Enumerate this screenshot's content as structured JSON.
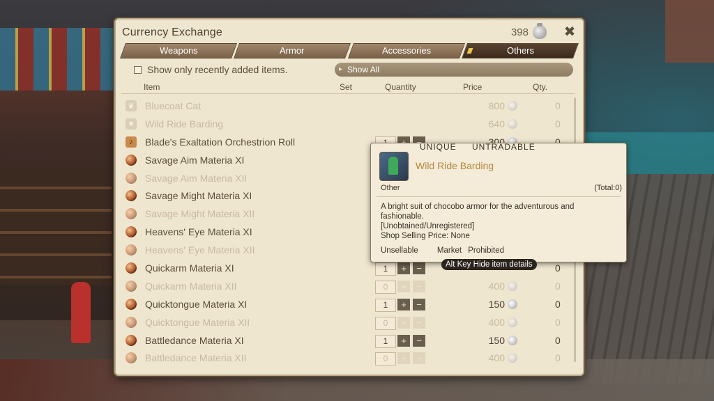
{
  "window": {
    "title": "Currency Exchange",
    "currency_amount": "398",
    "currency_icon": "gil-bag-icon",
    "settings_icon": "settings-icon"
  },
  "tabs": [
    {
      "label": "Weapons",
      "active": false
    },
    {
      "label": "Armor",
      "active": false
    },
    {
      "label": "Accessories",
      "active": false
    },
    {
      "label": "Others",
      "active": true
    }
  ],
  "filter": {
    "checkbox_label": "Show only recently added items.",
    "dropdown_value": "Show All"
  },
  "columns": {
    "item": "Item",
    "set": "Set",
    "quantity": "Quantity",
    "price": "Price",
    "qty": "Qty."
  },
  "items": [
    {
      "name": "Bluecoat Cat",
      "icon": "minion-icon",
      "dim": true,
      "quantity": "",
      "price": "800",
      "owned": "0",
      "controls": false
    },
    {
      "name": "Wild Ride Barding",
      "icon": "star-icon",
      "dim": true,
      "quantity": "",
      "price": "640",
      "owned": "0",
      "controls": false
    },
    {
      "name": "Blade's Exaltation Orchestrion Roll",
      "icon": "music-icon",
      "dim": false,
      "quantity": "1",
      "price": "300",
      "owned": "0",
      "controls": true
    },
    {
      "name": "Savage Aim Materia XI",
      "icon": "materia-icon",
      "dim": false,
      "quantity": "",
      "price": "",
      "owned": "",
      "controls": false
    },
    {
      "name": "Savage Aim Materia XII",
      "icon": "materia-icon",
      "dim": true,
      "quantity": "",
      "price": "",
      "owned": "",
      "controls": false
    },
    {
      "name": "Savage Might Materia XI",
      "icon": "materia-icon",
      "dim": false,
      "quantity": "",
      "price": "",
      "owned": "",
      "controls": false
    },
    {
      "name": "Savage Might Materia XII",
      "icon": "materia-icon",
      "dim": true,
      "quantity": "",
      "price": "",
      "owned": "",
      "controls": false
    },
    {
      "name": "Heavens' Eye Materia XI",
      "icon": "materia-icon",
      "dim": false,
      "quantity": "",
      "price": "",
      "owned": "",
      "controls": false
    },
    {
      "name": "Heavens' Eye Materia XII",
      "icon": "materia-icon",
      "dim": true,
      "quantity": "",
      "price": "",
      "owned": "",
      "controls": false
    },
    {
      "name": "Quickarm Materia XI",
      "icon": "materia-icon",
      "dim": false,
      "quantity": "1",
      "price": "",
      "owned": "0",
      "controls": true
    },
    {
      "name": "Quickarm Materia XII",
      "icon": "materia-icon",
      "dim": true,
      "quantity": "0",
      "price": "400",
      "owned": "0",
      "controls": true
    },
    {
      "name": "Quicktongue Materia XI",
      "icon": "materia-icon",
      "dim": false,
      "quantity": "1",
      "price": "150",
      "owned": "0",
      "controls": true
    },
    {
      "name": "Quicktongue Materia XII",
      "icon": "materia-icon",
      "dim": true,
      "quantity": "0",
      "price": "400",
      "owned": "0",
      "controls": true
    },
    {
      "name": "Battledance Materia XI",
      "icon": "materia-icon",
      "dim": false,
      "quantity": "1",
      "price": "150",
      "owned": "0",
      "controls": true
    },
    {
      "name": "Battledance Materia XII",
      "icon": "materia-icon",
      "dim": true,
      "quantity": "0",
      "price": "400",
      "owned": "0",
      "controls": true
    }
  ],
  "tooltip": {
    "tag_unique": "UNIQUE",
    "tag_untradable": "UNTRADABLE",
    "item_name": "Wild Ride Barding",
    "category": "Other",
    "total": "(Total:0)",
    "description_line1": "A bright suit of chocobo armor for the adventurous and fashionable.",
    "description_line2": "[Unobtained/Unregistered]",
    "description_line3": "Shop Selling Price: None",
    "flag_sell": "Unsellable",
    "flag_market": "Market Prohibited"
  },
  "hint": {
    "key": "Alt Key",
    "action": "Hide item details"
  }
}
